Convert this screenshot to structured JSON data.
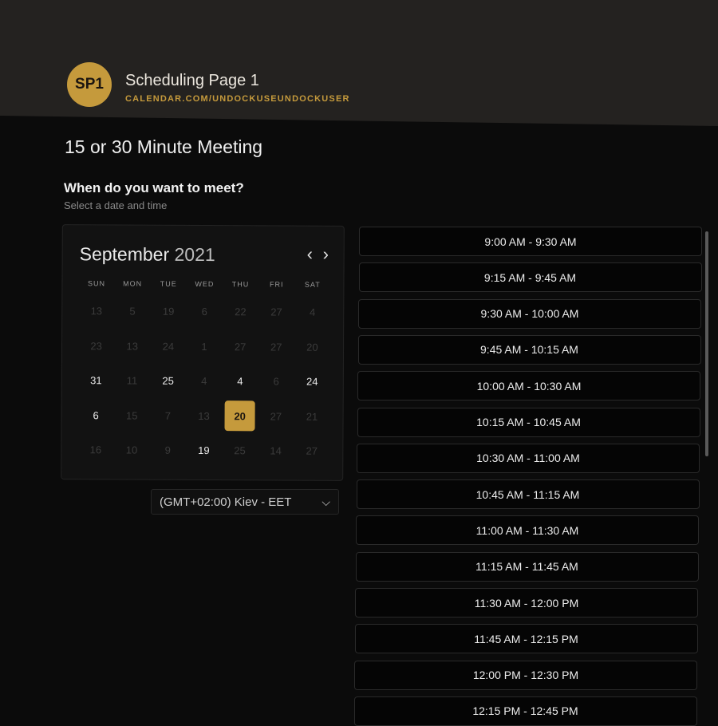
{
  "header": {
    "avatar_initials": "SP1",
    "page_name": "Scheduling Page 1",
    "page_url": "CALENDAR.COM/UNDOCKUSEUNDOCKUSER",
    "accent_color": "#c59a3c"
  },
  "meeting": {
    "title": "15 or 30 Minute Meeting",
    "question": "When do you want to meet?",
    "subquestion": "Select a date and time"
  },
  "calendar": {
    "month": "September",
    "year": "2021",
    "prev_icon": "chevron-left",
    "next_icon": "chevron-right",
    "weekdays": [
      "SUN",
      "MON",
      "TUE",
      "WED",
      "THU",
      "FRI",
      "SAT"
    ],
    "days": [
      {
        "label": "13",
        "active": false
      },
      {
        "label": "5",
        "active": false
      },
      {
        "label": "19",
        "active": false
      },
      {
        "label": "6",
        "active": false
      },
      {
        "label": "22",
        "active": false
      },
      {
        "label": "27",
        "active": false
      },
      {
        "label": "4",
        "active": false
      },
      {
        "label": "23",
        "active": false
      },
      {
        "label": "13",
        "active": false
      },
      {
        "label": "24",
        "active": false
      },
      {
        "label": "1",
        "active": false
      },
      {
        "label": "27",
        "active": false
      },
      {
        "label": "27",
        "active": false
      },
      {
        "label": "20",
        "active": false
      },
      {
        "label": "31",
        "active": true
      },
      {
        "label": "11",
        "active": false
      },
      {
        "label": "25",
        "active": true
      },
      {
        "label": "4",
        "active": false
      },
      {
        "label": "4",
        "active": true
      },
      {
        "label": "6",
        "active": false
      },
      {
        "label": "24",
        "active": true
      },
      {
        "label": "6",
        "active": true
      },
      {
        "label": "15",
        "active": false
      },
      {
        "label": "7",
        "active": false
      },
      {
        "label": "13",
        "active": false
      },
      {
        "label": "20",
        "active": true,
        "selected": true
      },
      {
        "label": "27",
        "active": false
      },
      {
        "label": "21",
        "active": false
      },
      {
        "label": "16",
        "active": false
      },
      {
        "label": "10",
        "active": false
      },
      {
        "label": "9",
        "active": false
      },
      {
        "label": "19",
        "active": true
      },
      {
        "label": "25",
        "active": false
      },
      {
        "label": "14",
        "active": false
      },
      {
        "label": "27",
        "active": false
      }
    ]
  },
  "timezone": {
    "selected": "(GMT+02:00) Kiev - EET",
    "icon": "chevron-down"
  },
  "time_slots": [
    "9:00 AM - 9:30 AM",
    "9:15 AM - 9:45 AM",
    "9:30 AM - 10:00 AM",
    "9:45 AM - 10:15 AM",
    "10:00 AM - 10:30 AM",
    "10:15 AM - 10:45 AM",
    "10:30 AM - 11:00 AM",
    "10:45 AM - 11:15 AM",
    "11:00 AM - 11:30 AM",
    "11:15 AM - 11:45 AM",
    "11:30 AM - 12:00 PM",
    "11:45 AM - 12:15 PM",
    "12:00 PM - 12:30 PM",
    "12:15 PM - 12:45 PM"
  ]
}
